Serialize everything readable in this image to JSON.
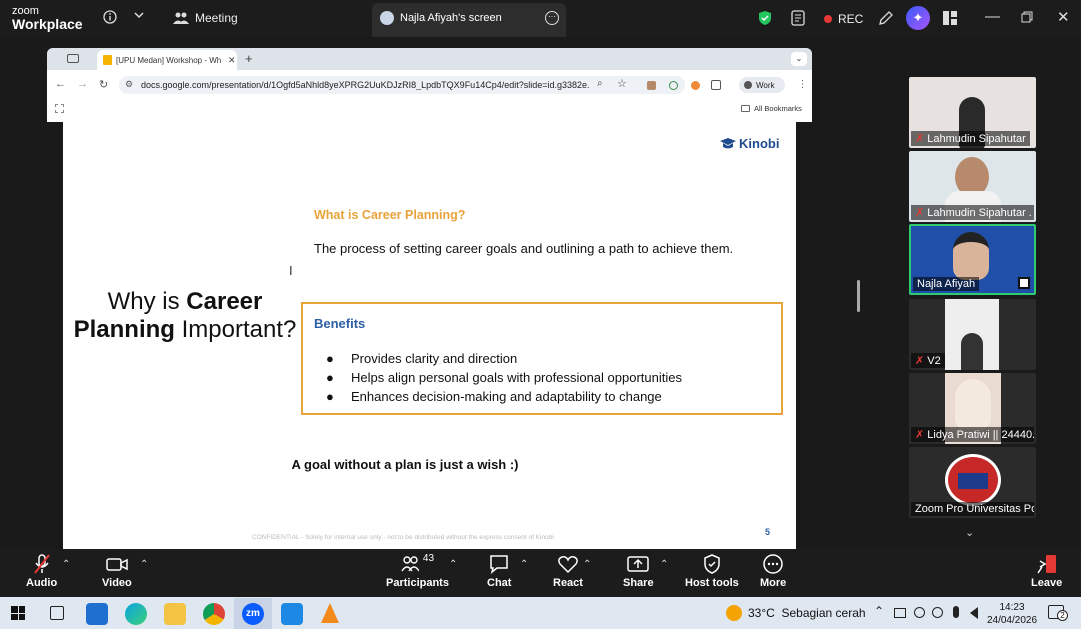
{
  "zoom": {
    "logo_line1": "zoom",
    "logo_line2": "Workplace",
    "meeting_label": "Meeting",
    "screen_tab_label": "Najla Afiyah's screen",
    "rec_label": "REC"
  },
  "browser": {
    "tab_title": "[UPU Medan] Workshop - Wh",
    "url": "docs.google.com/presentation/d/1Ogfd5aNhld8yeXPRG2UuKDJzRI8_LpdbTQX9Fu14Cp4/edit?slide=id.g3382e...",
    "profile_label": "Work",
    "bookmarks_label": "All Bookmarks"
  },
  "slide": {
    "brand": "Kinobi",
    "title_part1": "Why is ",
    "title_bold1": "Career",
    "title_bold2": "Planning",
    "title_part2": " Important?",
    "q_heading": "What is Career Planning?",
    "q_answer": "The process of setting career goals and outlining a path to achieve them.",
    "benefits_heading": "Benefits",
    "benefits": [
      "Provides clarity and direction",
      "Helps align personal goals with professional opportunities",
      "Enhances decision-making and adaptability to change"
    ],
    "quote": "A goal without a plan is just a wish :)",
    "footer": "CONFIDENTIAL - Solely for internal use only - not to be distributed without the express consent of Kinobi",
    "page_number": "5"
  },
  "participants_gallery": [
    {
      "name": "Lahmudin Sipahutar"
    },
    {
      "name": "Lahmudin Sipahutar ."
    },
    {
      "name": "Najla Afiyah"
    },
    {
      "name": "V2"
    },
    {
      "name": "Lidya Pratiwi || 24440..."
    },
    {
      "name": "Zoom Pro Universitas Po..."
    }
  ],
  "controls": {
    "audio": "Audio",
    "video": "Video",
    "participants": "Participants",
    "participants_count": "43",
    "chat": "Chat",
    "react": "React",
    "share": "Share",
    "host_tools": "Host tools",
    "more": "More",
    "leave": "Leave"
  },
  "taskbar": {
    "weather": "33°C  Sebagian cerah",
    "time": "14:23",
    "date": "24/04/2026",
    "notif_count": "2"
  },
  "colors": {
    "accent_orange": "#e8a33a",
    "benefits_blue": "#2d5fa6",
    "brand_blue": "#1e4c8f",
    "active_tile_border": "#2ecc71",
    "rec_red": "#e53935"
  }
}
